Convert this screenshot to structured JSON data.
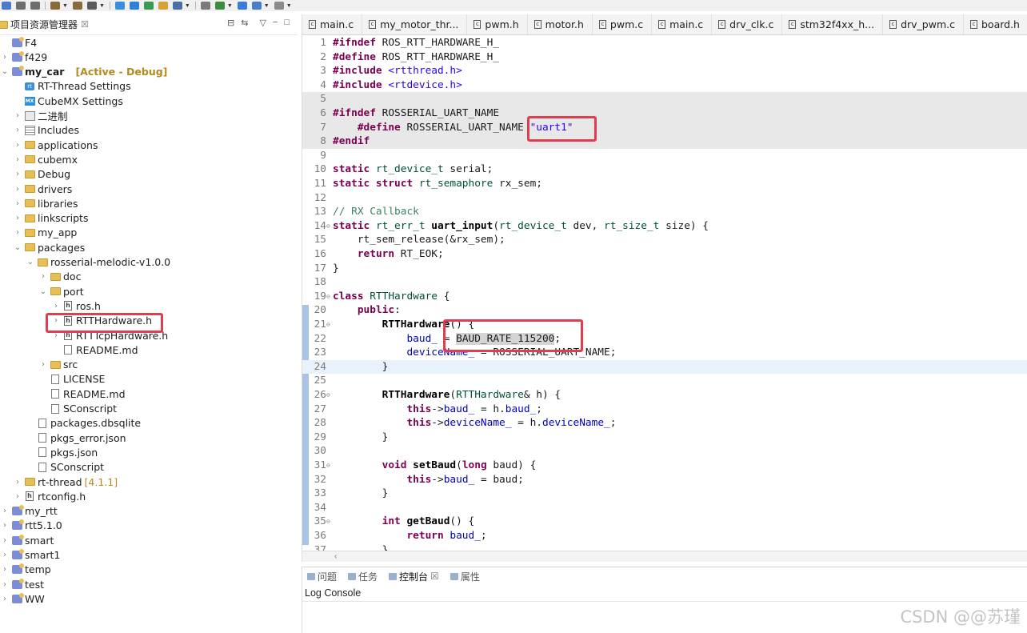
{
  "explorer": {
    "title": "项目资源管理器",
    "close_glyph": "☒",
    "tree": [
      {
        "label": "F4",
        "indent": 0,
        "twisty": "",
        "icon": "folder-closed-icon",
        "kind": "proj"
      },
      {
        "label": "f429",
        "indent": 0,
        "twisty": "›",
        "icon": "project-icon",
        "kind": "proj"
      },
      {
        "label": "my_car",
        "indent": 0,
        "twisty": "⌄",
        "icon": "project-icon",
        "kind": "proj",
        "bold": true,
        "suffix": "[Active - Debug]"
      },
      {
        "label": "RT-Thread Settings",
        "indent": 1,
        "twisty": "",
        "icon": "rtthread-icon",
        "kind": "rt"
      },
      {
        "label": "CubeMX Settings",
        "indent": 1,
        "twisty": "",
        "icon": "cubemx-icon",
        "kind": "mx"
      },
      {
        "label": "二进制",
        "indent": 1,
        "twisty": "›",
        "icon": "binaries-icon",
        "kind": "bin"
      },
      {
        "label": "Includes",
        "indent": 1,
        "twisty": "›",
        "icon": "includes-icon",
        "kind": "inc"
      },
      {
        "label": "applications",
        "indent": 1,
        "twisty": "›",
        "icon": "folder-icon",
        "kind": "folder"
      },
      {
        "label": "cubemx",
        "indent": 1,
        "twisty": "›",
        "icon": "folder-icon",
        "kind": "folder"
      },
      {
        "label": "Debug",
        "indent": 1,
        "twisty": "›",
        "icon": "folder-icon",
        "kind": "folder"
      },
      {
        "label": "drivers",
        "indent": 1,
        "twisty": "›",
        "icon": "folder-icon",
        "kind": "folder"
      },
      {
        "label": "libraries",
        "indent": 1,
        "twisty": "›",
        "icon": "folder-icon",
        "kind": "folder"
      },
      {
        "label": "linkscripts",
        "indent": 1,
        "twisty": "›",
        "icon": "folder-icon",
        "kind": "folder"
      },
      {
        "label": "my_app",
        "indent": 1,
        "twisty": "›",
        "icon": "folder-icon",
        "kind": "folder"
      },
      {
        "label": "packages",
        "indent": 1,
        "twisty": "⌄",
        "icon": "folder-open-icon",
        "kind": "folder"
      },
      {
        "label": "rosserial-melodic-v1.0.0",
        "indent": 2,
        "twisty": "⌄",
        "icon": "folder-open-icon",
        "kind": "folder"
      },
      {
        "label": "doc",
        "indent": 3,
        "twisty": "›",
        "icon": "folder-icon",
        "kind": "folder"
      },
      {
        "label": "port",
        "indent": 3,
        "twisty": "⌄",
        "icon": "folder-open-icon",
        "kind": "folder"
      },
      {
        "label": "ros.h",
        "indent": 4,
        "twisty": "›",
        "icon": "header-file-icon",
        "kind": "h"
      },
      {
        "label": "RTTHardware.h",
        "indent": 4,
        "twisty": "›",
        "icon": "header-file-icon",
        "kind": "h"
      },
      {
        "label": "RTTTcpHardware.h",
        "indent": 4,
        "twisty": "›",
        "icon": "header-file-icon",
        "kind": "h"
      },
      {
        "label": "README.md",
        "indent": 4,
        "twisty": "",
        "icon": "file-icon",
        "kind": "file"
      },
      {
        "label": "src",
        "indent": 3,
        "twisty": "›",
        "icon": "folder-icon",
        "kind": "folder"
      },
      {
        "label": "LICENSE",
        "indent": 3,
        "twisty": "",
        "icon": "file-icon",
        "kind": "file"
      },
      {
        "label": "README.md",
        "indent": 3,
        "twisty": "",
        "icon": "file-icon",
        "kind": "file"
      },
      {
        "label": "SConscript",
        "indent": 3,
        "twisty": "",
        "icon": "file-icon",
        "kind": "file"
      },
      {
        "label": "packages.dbsqlite",
        "indent": 2,
        "twisty": "",
        "icon": "file-icon",
        "kind": "file"
      },
      {
        "label": "pkgs_error.json",
        "indent": 2,
        "twisty": "",
        "icon": "file-icon",
        "kind": "file"
      },
      {
        "label": "pkgs.json",
        "indent": 2,
        "twisty": "",
        "icon": "file-icon",
        "kind": "file"
      },
      {
        "label": "SConscript",
        "indent": 2,
        "twisty": "",
        "icon": "file-icon",
        "kind": "file"
      },
      {
        "label": "rt-thread",
        "indent": 1,
        "twisty": "›",
        "icon": "folder-icon",
        "kind": "folder",
        "version": "[4.1.1]"
      },
      {
        "label": "rtconfig.h",
        "indent": 1,
        "twisty": "›",
        "icon": "header-file-icon",
        "kind": "h"
      },
      {
        "label": "my_rtt",
        "indent": 0,
        "twisty": "›",
        "icon": "project-icon",
        "kind": "proj"
      },
      {
        "label": "rtt5.1.0",
        "indent": 0,
        "twisty": "›",
        "icon": "project-icon",
        "kind": "proj"
      },
      {
        "label": "smart",
        "indent": 0,
        "twisty": "›",
        "icon": "project-icon",
        "kind": "proj"
      },
      {
        "label": "smart1",
        "indent": 0,
        "twisty": "›",
        "icon": "project-icon",
        "kind": "proj"
      },
      {
        "label": "temp",
        "indent": 0,
        "twisty": "›",
        "icon": "project-icon",
        "kind": "proj"
      },
      {
        "label": "test",
        "indent": 0,
        "twisty": "›",
        "icon": "project-icon",
        "kind": "proj"
      },
      {
        "label": "WW",
        "indent": 0,
        "twisty": "›",
        "icon": "project-icon",
        "kind": "proj"
      }
    ]
  },
  "editor": {
    "tabs": [
      "main.c",
      "my_motor_thr...",
      "pwm.h",
      "motor.h",
      "pwm.c",
      "main.c",
      "drv_clk.c",
      "stm32f4xx_h...",
      "drv_pwm.c",
      "board.h"
    ],
    "lines": [
      {
        "n": "1",
        "t": [
          [
            "pp",
            "#ifndef "
          ],
          [
            "",
            "ROS_RTT_HARDWARE_H_"
          ]
        ]
      },
      {
        "n": "2",
        "t": [
          [
            "pp",
            "#define "
          ],
          [
            "",
            "ROS_RTT_HARDWARE_H_"
          ]
        ]
      },
      {
        "n": "3",
        "t": [
          [
            "pp",
            "#include "
          ],
          [
            "str",
            "<rtthread.h>"
          ]
        ]
      },
      {
        "n": "4",
        "t": [
          [
            "pp",
            "#include "
          ],
          [
            "str",
            "<rtdevice.h>"
          ]
        ]
      },
      {
        "n": "5",
        "t": [],
        "bg": "gray"
      },
      {
        "n": "6",
        "t": [
          [
            "pp",
            "#ifndef "
          ],
          [
            "",
            "ROSSERIAL_UART_NAME"
          ]
        ],
        "bg": "gray"
      },
      {
        "n": "7",
        "t": [
          [
            "",
            "    "
          ],
          [
            "pp",
            "#define "
          ],
          [
            "",
            "ROSSERIAL_UART_NAME "
          ],
          [
            "str",
            "\"uart1\""
          ]
        ],
        "bg": "gray"
      },
      {
        "n": "8",
        "t": [
          [
            "pp",
            "#endif"
          ]
        ],
        "bg": "gray"
      },
      {
        "n": "9",
        "t": []
      },
      {
        "n": "10",
        "t": [
          [
            "kw",
            "static "
          ],
          [
            "ty",
            "rt_device_t "
          ],
          [
            "",
            "serial;"
          ]
        ]
      },
      {
        "n": "11",
        "t": [
          [
            "kw",
            "static struct "
          ],
          [
            "ty",
            "rt_semaphore "
          ],
          [
            "",
            "rx_sem;"
          ]
        ]
      },
      {
        "n": "12",
        "t": []
      },
      {
        "n": "13",
        "t": [
          [
            "cm",
            "// RX Callback"
          ]
        ]
      },
      {
        "n": "14",
        "fold": true,
        "t": [
          [
            "kw",
            "static "
          ],
          [
            "ty",
            "rt_err_t "
          ],
          [
            "fn",
            "uart_input"
          ],
          [
            "",
            "("
          ],
          [
            "ty",
            "rt_device_t "
          ],
          [
            "",
            "dev, "
          ],
          [
            "ty",
            "rt_size_t "
          ],
          [
            "",
            "size) {"
          ]
        ]
      },
      {
        "n": "15",
        "t": [
          [
            "",
            "    rt_sem_release(&rx_sem);"
          ]
        ]
      },
      {
        "n": "16",
        "t": [
          [
            "",
            "    "
          ],
          [
            "kw",
            "return "
          ],
          [
            "",
            "RT_EOK;"
          ]
        ]
      },
      {
        "n": "17",
        "t": [
          [
            "",
            "}"
          ]
        ]
      },
      {
        "n": "18",
        "t": []
      },
      {
        "n": "19",
        "fold": true,
        "t": [
          [
            "kw",
            "class "
          ],
          [
            "ty",
            "RTTHardware "
          ],
          [
            "",
            "{"
          ]
        ]
      },
      {
        "n": "20",
        "t": [
          [
            "",
            "    "
          ],
          [
            "kw",
            "public"
          ],
          [
            "",
            ":"
          ]
        ]
      },
      {
        "n": "21",
        "fold": true,
        "t": [
          [
            "",
            "        "
          ],
          [
            "fn",
            "RTTHardware"
          ],
          [
            "",
            "() {"
          ]
        ]
      },
      {
        "n": "22",
        "t": [
          [
            "",
            "            "
          ],
          [
            "fld",
            "baud_"
          ],
          [
            "",
            " = "
          ],
          [
            "hlw",
            "BAUD_RATE_115200"
          ],
          [
            "",
            ";"
          ]
        ]
      },
      {
        "n": "23",
        "t": [
          [
            "",
            "            "
          ],
          [
            "fld",
            "deviceName_"
          ],
          [
            "",
            " = ROSSERIAL_UART_NAME;"
          ]
        ]
      },
      {
        "n": "24",
        "t": [
          [
            "",
            "        }"
          ]
        ],
        "bg": "cur"
      },
      {
        "n": "25",
        "t": []
      },
      {
        "n": "26",
        "fold": true,
        "t": [
          [
            "",
            "        "
          ],
          [
            "fn",
            "RTTHardware"
          ],
          [
            "",
            "("
          ],
          [
            "ty",
            "RTTHardware"
          ],
          [
            "",
            "& h) {"
          ]
        ]
      },
      {
        "n": "27",
        "t": [
          [
            "",
            "            "
          ],
          [
            "kw",
            "this"
          ],
          [
            "",
            "->"
          ],
          [
            "fld",
            "baud_"
          ],
          [
            "",
            " = h."
          ],
          [
            "fld",
            "baud_"
          ],
          [
            "",
            ";"
          ]
        ]
      },
      {
        "n": "28",
        "t": [
          [
            "",
            "            "
          ],
          [
            "kw",
            "this"
          ],
          [
            "",
            "->"
          ],
          [
            "fld",
            "deviceName_"
          ],
          [
            "",
            " = h."
          ],
          [
            "fld",
            "deviceName_"
          ],
          [
            "",
            ";"
          ]
        ]
      },
      {
        "n": "29",
        "t": [
          [
            "",
            "        }"
          ]
        ]
      },
      {
        "n": "30",
        "t": []
      },
      {
        "n": "31",
        "fold": true,
        "t": [
          [
            "",
            "        "
          ],
          [
            "kw",
            "void "
          ],
          [
            "fn",
            "setBaud"
          ],
          [
            "",
            "("
          ],
          [
            "kw",
            "long "
          ],
          [
            "",
            "baud) {"
          ]
        ]
      },
      {
        "n": "32",
        "t": [
          [
            "",
            "            "
          ],
          [
            "kw",
            "this"
          ],
          [
            "",
            "->"
          ],
          [
            "fld",
            "baud_"
          ],
          [
            "",
            " = baud;"
          ]
        ]
      },
      {
        "n": "33",
        "t": [
          [
            "",
            "        }"
          ]
        ]
      },
      {
        "n": "34",
        "t": []
      },
      {
        "n": "35",
        "fold": true,
        "t": [
          [
            "",
            "        "
          ],
          [
            "kw",
            "int "
          ],
          [
            "fn",
            "getBaud"
          ],
          [
            "",
            "() {"
          ]
        ]
      },
      {
        "n": "36",
        "t": [
          [
            "",
            "            "
          ],
          [
            "kw",
            "return "
          ],
          [
            "fld",
            "baud_"
          ],
          [
            "",
            ";"
          ]
        ]
      },
      {
        "n": "37",
        "t": [
          [
            "",
            "        }"
          ]
        ]
      }
    ]
  },
  "console": {
    "tabs": [
      {
        "label": "问题",
        "icon": "problems-icon",
        "active": false
      },
      {
        "label": "任务",
        "icon": "tasks-icon",
        "active": false
      },
      {
        "label": "控制台",
        "icon": "console-icon",
        "active": true,
        "close": "☒"
      },
      {
        "label": "属性",
        "icon": "properties-icon",
        "active": false
      }
    ],
    "title": "Log Console"
  },
  "watermark": "CSDN @@苏瑾",
  "colors": {
    "highlight_box": "#e23c4e",
    "keyword": "#7b0052",
    "string": "#2a00ff",
    "field": "#0000c0",
    "comment": "#3f7f5f"
  }
}
